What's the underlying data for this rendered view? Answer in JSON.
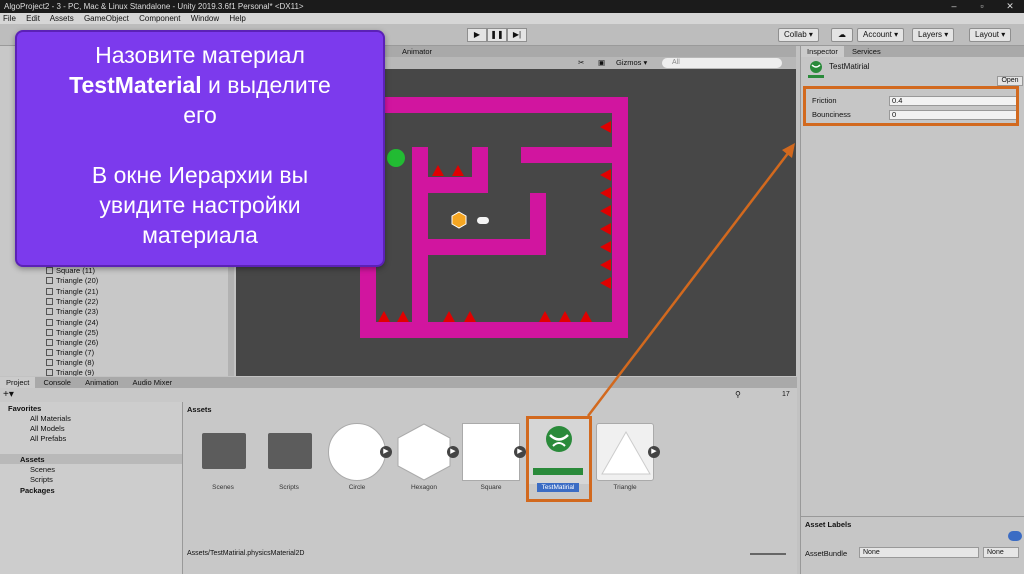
{
  "window": {
    "title": "AlgoProject2 - 3 - PC, Mac & Linux Standalone - Unity 2019.3.6f1 Personal* <DX11>"
  },
  "menu": [
    "File",
    "Edit",
    "Assets",
    "GameObject",
    "Component",
    "Window",
    "Help"
  ],
  "toolbar": {
    "collab": "Collab ▾",
    "account": "Account ▾",
    "layers": "Layers ▾",
    "layout": "Layout ▾"
  },
  "scene": {
    "tab_animator": "Animator",
    "gizmos": "Gizmos ▾",
    "search": "All"
  },
  "hierarchy": {
    "items": [
      "Square (11)",
      "Triangle (20)",
      "Triangle (21)",
      "Triangle (22)",
      "Triangle (23)",
      "Triangle (24)",
      "Triangle (25)",
      "Triangle (26)",
      "Triangle (7)",
      "Triangle (8)",
      "Triangle (9)"
    ]
  },
  "inspector": {
    "tabs": [
      "Inspector",
      "Services"
    ],
    "object_name": "TestMatirial",
    "open_button": "Open",
    "fields": [
      {
        "label": "Friction",
        "value": "0.4"
      },
      {
        "label": "Bounciness",
        "value": "0"
      }
    ],
    "asset_labels": "Asset Labels",
    "asset_bundle_label": "AssetBundle",
    "asset_bundle_value": "None",
    "asset_bundle_variant": "None"
  },
  "project": {
    "tabs": [
      "Project",
      "Console",
      "Animation",
      "Audio Mixer"
    ],
    "favorites_label": "Favorites",
    "favorites": [
      "All Materials",
      "All Models",
      "All Prefabs"
    ],
    "assets_label": "Assets",
    "asset_folders": [
      "Scenes",
      "Scripts"
    ],
    "packages_label": "Packages",
    "breadcrumb": "Assets",
    "items": [
      "Scenes",
      "Scripts",
      "Circle",
      "Hexagon",
      "Square",
      "TestMatirial",
      "Triangle"
    ],
    "path": "Assets/TestMatirial.physicsMaterial2D",
    "count": "17"
  },
  "callout": {
    "line1": "Назовите материал",
    "bold": "TestMaterial",
    "line2_rest": " и выделите",
    "line3": "его",
    "line4": "В окне Иерархии вы",
    "line5": "увидите настройки",
    "line6": "материала"
  },
  "colors": {
    "callout": "#7c3aed",
    "highlight": "#d2691e",
    "wall": "#d1159f",
    "spike": "#e00000",
    "player": "#22bb33",
    "coin": "#f5a623"
  }
}
